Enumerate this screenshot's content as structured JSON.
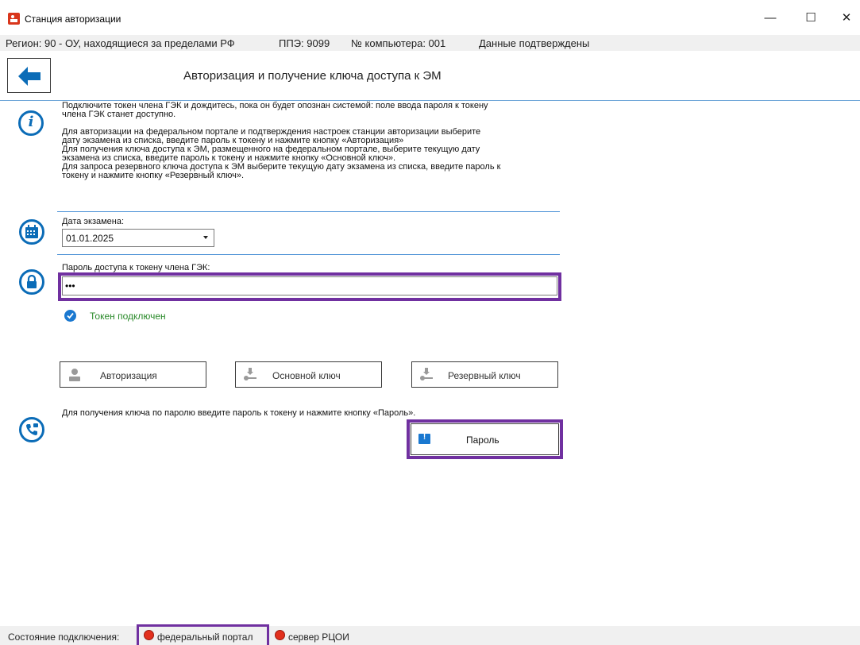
{
  "window": {
    "title": "Станция авторизации",
    "minimize_glyph": "—",
    "maximize_glyph": "☐",
    "close_glyph": "✕"
  },
  "infobar": {
    "region": "Регион: 90 - ОУ, находящиеся за пределами РФ",
    "ppe": "ППЭ: 9099",
    "computer": "№ компьютера: 001",
    "status": "Данные подтверждены"
  },
  "header": {
    "back_icon": "arrow-left-icon",
    "title": "Авторизация и получение ключа доступа к ЭМ"
  },
  "instructions": {
    "icon": "info-icon",
    "lines": [
      "Подключите токен члена ГЭК и дождитесь, пока он будет опознан системой: поле ввода пароля к токену",
      "члена ГЭК станет доступно.",
      "",
      "Для авторизации на федеральном портале и подтверждения настроек станции авторизации выберите",
      "дату экзамена из списка, введите пароль к токену и нажмите кнопку «Авторизация»",
      "Для получения ключа доступа к ЭМ, размещенного на федеральном портале, выберите текущую дату",
      "экзамена из списка, введите пароль к токену и нажмите кнопку «Основной ключ».",
      "Для запроса резервного ключа доступа к ЭМ выберите текущую дату экзамена из списка, введите пароль к",
      "токену и нажмите кнопку «Резервный ключ»."
    ]
  },
  "exam_date": {
    "label": "Дата экзамена:",
    "value": "01.01.2025",
    "icon": "calendar-icon"
  },
  "password": {
    "label": "Пароль доступа к токену члена ГЭК:",
    "value": "•••",
    "icon": "lock-icon"
  },
  "token": {
    "status": "Токен подключен",
    "icon": "check-circle-icon",
    "color": "#2a8a2a"
  },
  "actions": {
    "auth_label": "Авторизация",
    "main_key_label": "Основной ключ",
    "reserve_key_label": "Резервный ключ"
  },
  "password_key": {
    "icon": "phone-icon",
    "hint": "Для получения ключа по паролю введите пароль к токену и нажмите кнопку «Пароль».",
    "button_label": "Пароль",
    "button_glyph": "!"
  },
  "statusbar": {
    "label": "Состояние подключения:",
    "portal": "федеральный портал",
    "rcoi": "сервер РЦОИ",
    "indicator_color": "#e2301d"
  },
  "colors": {
    "accent": "#0b6cb7",
    "highlight": "#7030a0"
  }
}
